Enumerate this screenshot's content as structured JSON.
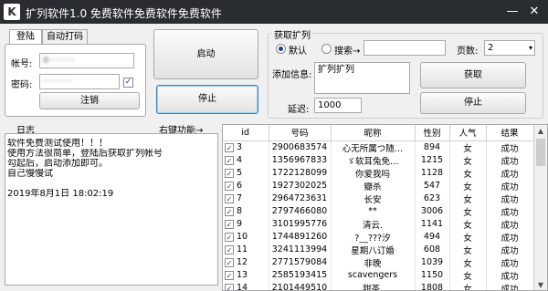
{
  "title": {
    "text": "扩列软件1.0  免费软件免费软件免费软件",
    "logo_letter": "K"
  },
  "window_controls": {
    "minimize": "—",
    "close": "✕"
  },
  "login": {
    "tabs": [
      "登陆",
      "自动打码"
    ],
    "account_label": "帐号:",
    "account_value": "8·········",
    "password_label": "密码:",
    "password_value": "··········",
    "remember_checked": "✓",
    "logout_button": "注销"
  },
  "controls": {
    "start_button": "启动",
    "stop_button": "停止"
  },
  "fetch": {
    "group_title": "获取扩列",
    "mode_default": "默认",
    "mode_search": "搜索→",
    "page_label": "页数:",
    "page_value": "2",
    "add_info_label": "添加信息:",
    "add_info_value": "扩列扩列",
    "delay_label": "延迟:",
    "delay_value": "1000",
    "fetch_button": "获取",
    "stop_button": "停止"
  },
  "log": {
    "title": "日志",
    "right_function": "右键功能→",
    "lines": [
      "软件免费测试使用！！！",
      "使用方法很简单，登陆后获取扩列帐号",
      "勾起后，启动添加即可。",
      "自己慢慢试",
      "",
      "2019年8月1日  18:02:19"
    ]
  },
  "table": {
    "columns": [
      "id",
      "号码",
      "昵称",
      "性别",
      "人气",
      "结果"
    ],
    "rows": [
      [
        "3",
        "2900683574",
        "心无所属つ随…",
        "894",
        "女",
        "成功"
      ],
      [
        "4",
        "1356967833",
        "ゞ软耳兔免…",
        "1215",
        "女",
        "成功"
      ],
      [
        "5",
        "1722128099",
        "你爱我吗",
        "1128",
        "女",
        "成功"
      ],
      [
        "6",
        "1927302025",
        "瓣杀",
        "547",
        "女",
        "成功"
      ],
      [
        "7",
        "2964723631",
        "长安",
        "623",
        "女",
        "成功"
      ],
      [
        "8",
        "2797466080",
        "**",
        "3006",
        "女",
        "成功"
      ],
      [
        "9",
        "3101995776",
        "清云.",
        "1141",
        "女",
        "成功"
      ],
      [
        "10",
        "1744891260",
        "?__???汐",
        "494",
        "女",
        "成功"
      ],
      [
        "11",
        "3241113994",
        "星期八订婚",
        "608",
        "女",
        "成功"
      ],
      [
        "12",
        "2771579084",
        "非晚",
        "1039",
        "女",
        "成功"
      ],
      [
        "13",
        "2585193415",
        "scavengers",
        "1150",
        "女",
        "成功"
      ],
      [
        "14",
        "2101449510",
        "甜茶.",
        "1808",
        "女",
        "成功"
      ]
    ],
    "check_mark": "✓"
  },
  "scrollbar": {
    "up": "▲",
    "down": "▼"
  }
}
